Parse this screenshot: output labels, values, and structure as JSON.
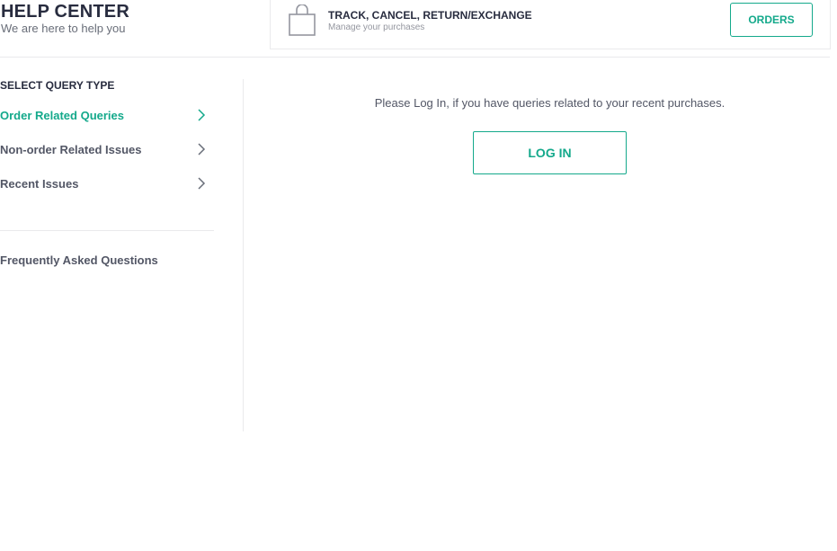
{
  "header": {
    "title": "HELP CENTER",
    "subtitle": "We are here to help you"
  },
  "track_card": {
    "icon": "shopping-bag-icon",
    "title": "TRACK, CANCEL, RETURN/EXCHANGE",
    "subtitle": "Manage your purchases",
    "button_label": "ORDERS"
  },
  "sidebar": {
    "heading": "SELECT QUERY TYPE",
    "items": [
      {
        "label": "Order Related Queries",
        "active": true
      },
      {
        "label": "Non-order Related Issues",
        "active": false
      },
      {
        "label": "Recent Issues",
        "active": false
      }
    ],
    "faq_label": "Frequently Asked Questions"
  },
  "main": {
    "message": "Please Log In, if you have queries related to your recent purchases.",
    "login_label": "LOG IN"
  },
  "colors": {
    "accent": "#14a98b",
    "text_dark": "#282c3f",
    "text_muted": "#535766",
    "border": "#eaeaec"
  }
}
